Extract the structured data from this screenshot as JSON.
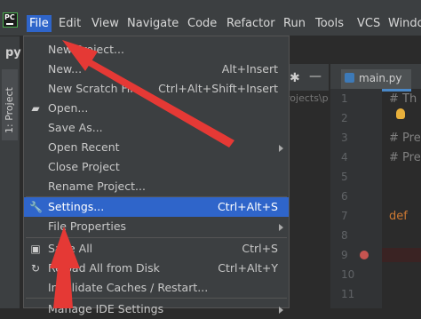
{
  "app": {
    "icon_text": "PC",
    "side_label": "py"
  },
  "menubar": {
    "items": [
      "File",
      "Edit",
      "View",
      "Navigate",
      "Code",
      "Refactor",
      "Run",
      "Tools",
      "VCS",
      "Windo"
    ]
  },
  "left_strip": {
    "project_tab": "1: Project"
  },
  "editor": {
    "tab_label": "main.py",
    "path_fragment": "rojects\\p",
    "line_numbers": [
      "1",
      "2",
      "3",
      "4",
      "5",
      "6",
      "7",
      "8",
      "9",
      "10",
      "11"
    ],
    "code_lines": [
      "# Th",
      "# Pre",
      "# Pre",
      "def "
    ]
  },
  "file_menu": {
    "items": [
      {
        "label": "New Project...",
        "shortcut": "",
        "icon": "",
        "submenu": false
      },
      {
        "label": "New...",
        "shortcut": "Alt+Insert",
        "icon": "",
        "submenu": false
      },
      {
        "label": "New Scratch File",
        "shortcut": "Ctrl+Alt+Shift+Insert",
        "icon": "",
        "submenu": false
      },
      {
        "label": "Open...",
        "shortcut": "",
        "icon": "folder-icon",
        "submenu": false
      },
      {
        "label": "Save As...",
        "shortcut": "",
        "icon": "",
        "submenu": false
      },
      {
        "label": "Open Recent",
        "shortcut": "",
        "icon": "",
        "submenu": true
      },
      {
        "label": "Close Project",
        "shortcut": "",
        "icon": "",
        "submenu": false
      },
      {
        "label": "Rename Project...",
        "shortcut": "",
        "icon": "",
        "submenu": false
      },
      {
        "label": "Settings...",
        "shortcut": "Ctrl+Alt+S",
        "icon": "wrench-icon",
        "submenu": false,
        "selected": true
      },
      {
        "label": "File Properties",
        "shortcut": "",
        "icon": "",
        "submenu": true
      },
      {
        "label": "Save All",
        "shortcut": "Ctrl+S",
        "icon": "save-icon",
        "submenu": false
      },
      {
        "label": "Reload All from Disk",
        "shortcut": "Ctrl+Alt+Y",
        "icon": "reload-icon",
        "submenu": false
      },
      {
        "label": "Invalidate Caches / Restart...",
        "shortcut": "",
        "icon": "",
        "submenu": false
      },
      {
        "label": "Manage IDE Settings",
        "shortcut": "",
        "icon": "",
        "submenu": true
      }
    ]
  },
  "colors": {
    "selection": "#2f65ca",
    "annotation_arrow": "#e53935"
  }
}
